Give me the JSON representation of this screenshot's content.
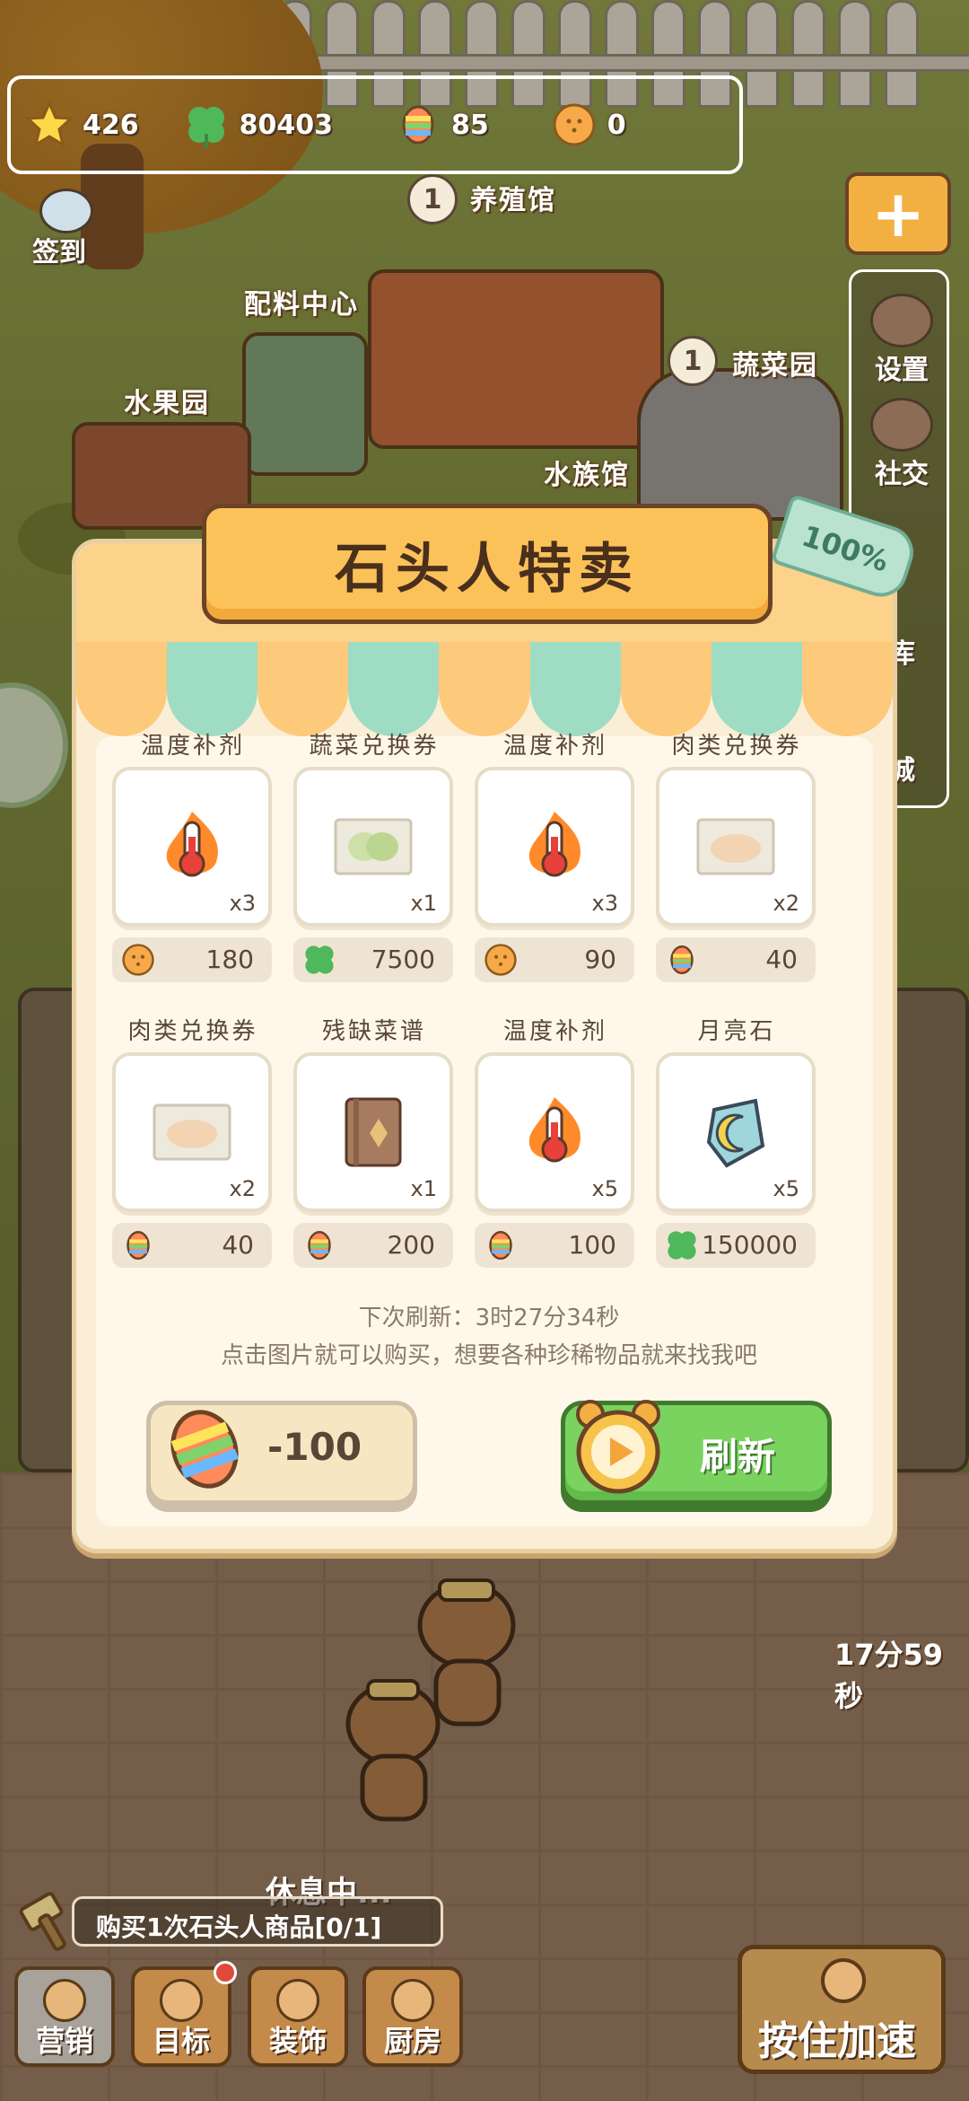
{
  "resources": [
    {
      "icon": "star-icon",
      "value": "426"
    },
    {
      "icon": "clover-icon",
      "value": "80403"
    },
    {
      "icon": "candy-icon",
      "value": "85"
    },
    {
      "icon": "biscuit-icon",
      "value": "0"
    }
  ],
  "signin": {
    "label": "签到"
  },
  "map": {
    "breeding_hall": {
      "level": "1",
      "label": "养殖馆"
    },
    "vegetable_garden": {
      "level": "1",
      "label": "蔬菜园"
    },
    "ingredient_center": "配料中心",
    "fruit_garden": "水果园",
    "aquatic_hall": "水族馆"
  },
  "side_menu": {
    "plus": "+",
    "items": [
      "设置",
      "社交",
      "库",
      "城"
    ]
  },
  "popup": {
    "title": "石头人特卖",
    "progress_tag": "100%",
    "items": [
      {
        "name": "温度补剂",
        "art": "thermometer",
        "qty": "x3",
        "price_icon": "biscuit-icon",
        "price": "180"
      },
      {
        "name": "蔬菜兑换券",
        "art": "veg-ticket",
        "qty": "x1",
        "price_icon": "clover-icon",
        "price": "7500"
      },
      {
        "name": "温度补剂",
        "art": "thermometer",
        "qty": "x3",
        "price_icon": "biscuit-icon",
        "price": "90"
      },
      {
        "name": "肉类兑换券",
        "art": "meat-ticket",
        "qty": "x2",
        "price_icon": "candy-icon",
        "price": "40"
      },
      {
        "name": "肉类兑换券",
        "art": "meat-ticket",
        "qty": "x2",
        "price_icon": "candy-icon",
        "price": "40"
      },
      {
        "name": "残缺菜谱",
        "art": "recipe-book",
        "qty": "x1",
        "price_icon": "candy-icon",
        "price": "200"
      },
      {
        "name": "温度补剂",
        "art": "thermometer",
        "qty": "x5",
        "price_icon": "candy-icon",
        "price": "100"
      },
      {
        "name": "月亮石",
        "art": "moonstone",
        "qty": "x5",
        "price_icon": "clover-icon",
        "price": "150000"
      }
    ],
    "next_refresh": "下次刷新：3时27分34秒",
    "hint": "点击图片就可以购买，想要各种珍稀物品就来找我吧",
    "cost_button": "-100",
    "refresh_button": "刷新"
  },
  "bottom": {
    "quest": "购买1次石头人商品[0/1]",
    "rest_label": "休息中...",
    "timer": "17分59秒",
    "nav": [
      "营销",
      "目标",
      "装饰",
      "厨房"
    ],
    "speed_button": "按住加速"
  },
  "colors": {
    "awning_orange": "#fdc97a",
    "awning_green": "#9fdcc4",
    "accent_green": "#7ad25f"
  }
}
